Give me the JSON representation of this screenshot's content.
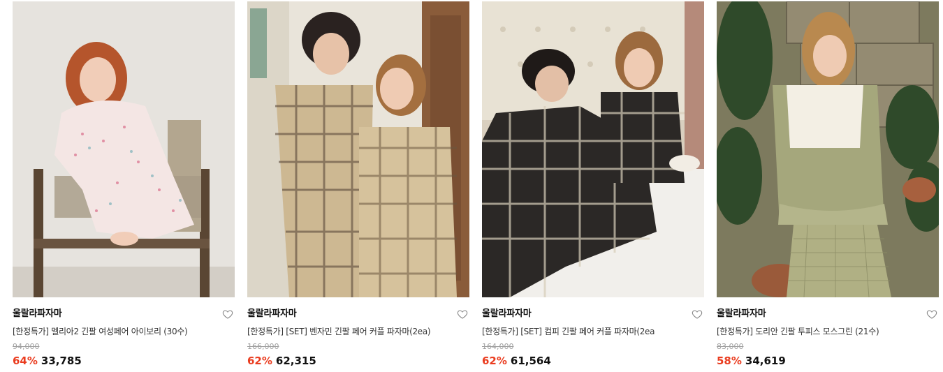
{
  "products": [
    {
      "brand": "울랄라파자마",
      "name": "[한정특가] 멜리아2 긴팔 여성페어 아이보리 (30수)",
      "original_price": "94,000",
      "discount": "64%",
      "price": "33,785",
      "image_icon": "photo-floral-pajama-woman"
    },
    {
      "brand": "울랄라파자마",
      "name": "[한정특가] [SET] 벤자민 긴팔 페어 커플 파자마(2ea)",
      "original_price": "166,000",
      "discount": "62%",
      "price": "62,315",
      "image_icon": "photo-beige-plaid-couple"
    },
    {
      "brand": "울랄라파자마",
      "name": "[한정특가] [SET] 컴피 긴팔 페어 커플 파자마(2ea",
      "original_price": "164,000",
      "discount": "62%",
      "price": "61,564",
      "image_icon": "photo-dark-plaid-couple-bed"
    },
    {
      "brand": "울랄라파자마",
      "name": "[한정특가] 도리안 긴팔 투피스 모스그린 (21수)",
      "original_price": "83,000",
      "discount": "58%",
      "price": "34,619",
      "image_icon": "photo-green-check-pajama-woman"
    }
  ],
  "colors": {
    "discount": "#ea3c1f",
    "original_price": "#a0a0a0",
    "text": "#111111"
  }
}
